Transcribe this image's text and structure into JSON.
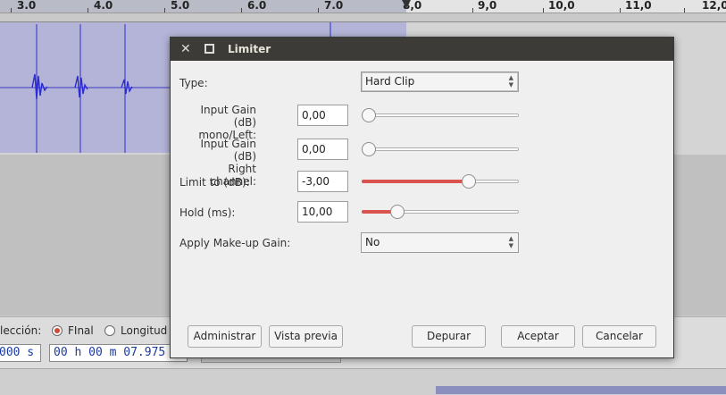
{
  "ruler": {
    "ticks": [
      "3.0",
      "4.0",
      "5.0",
      "6.0",
      "7.0",
      "8,0",
      "9,0",
      "10,0",
      "11,0",
      "12,0"
    ]
  },
  "selection_toolbar": {
    "selection_label": "lección:",
    "end_option": "FInal",
    "length_option": "Longitud",
    "snap_value": "000 s",
    "time_value": "00 h 00 m 07.975"
  },
  "dialog": {
    "title": "Limiter",
    "fields": {
      "type": {
        "label": "Type:",
        "value": "Hard Clip"
      },
      "input_gain_left": {
        "label_line1": "Input Gain (dB)",
        "label_line2": "mono/Left:",
        "value": "0,00",
        "slider_fraction": 0.0
      },
      "input_gain_right": {
        "label_line1": "Input Gain (dB)",
        "label_line2": "Right channel:",
        "value": "0,00",
        "slider_fraction": 0.0
      },
      "limit_to": {
        "label": "Limit to (dB):",
        "value": "-3,00",
        "slider_fraction": 0.7
      },
      "hold": {
        "label": "Hold (ms):",
        "value": "10,00",
        "slider_fraction": 0.2
      },
      "makeup_gain": {
        "label": "Apply Make-up Gain:",
        "value": "No"
      }
    },
    "buttons": {
      "manage": "Administrar",
      "preview": "Vista previa",
      "debug": "Depurar",
      "ok": "Aceptar",
      "cancel": "Cancelar"
    }
  },
  "colors": {
    "slider_fill": "#d9534f",
    "titlebar": "#3c3b37",
    "selection": "#b4b4d8",
    "time_text": "#1a3aa0"
  },
  "icons": {
    "close": "close-icon",
    "maximize": "maximize-icon"
  }
}
